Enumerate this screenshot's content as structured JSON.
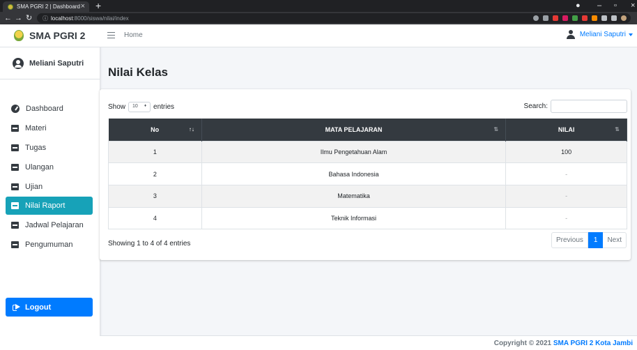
{
  "browser": {
    "tab_title": "SMA PGRI 2 | Dashboard",
    "url_host": "localhost",
    "url_rest": ":8000/siswa/nilai/index",
    "new_tab": "+",
    "tab_close": "×"
  },
  "sidebar": {
    "brand": "SMA PGRI 2",
    "user": "Meliani Saputri",
    "items": [
      {
        "label": "Dashboard",
        "icon": "dashboard-icon",
        "active": false
      },
      {
        "label": "Materi",
        "icon": "book-icon",
        "active": false
      },
      {
        "label": "Tugas",
        "icon": "book-icon",
        "active": false
      },
      {
        "label": "Ulangan",
        "icon": "book-icon",
        "active": false
      },
      {
        "label": "Ujian",
        "icon": "book-icon",
        "active": false
      },
      {
        "label": "Nilai Raport",
        "icon": "book-icon",
        "active": true
      },
      {
        "label": "Jadwal Pelajaran",
        "icon": "book-icon",
        "active": false
      },
      {
        "label": "Pengumuman",
        "icon": "book-icon",
        "active": false
      }
    ],
    "logout": "Logout"
  },
  "navbar": {
    "home": "Home",
    "user": "Meliani Saputri"
  },
  "page": {
    "title": "Nilai Kelas"
  },
  "table_controls": {
    "show": "Show",
    "length_value": "10",
    "entries": "entries",
    "search_label": "Search:",
    "search_value": ""
  },
  "table": {
    "headers": [
      "No",
      "MATA PELAJARAN",
      "NILAI"
    ],
    "rows": [
      [
        "1",
        "Ilmu Pengetahuan Alam",
        "100"
      ],
      [
        "2",
        "Bahasa Indonesia",
        "-"
      ],
      [
        "3",
        "Matematika",
        "-"
      ],
      [
        "4",
        "Teknik Informasi",
        "-"
      ]
    ]
  },
  "pagination": {
    "info": "Showing 1 to 4 of 4 entries",
    "previous": "Previous",
    "current": "1",
    "next": "Next"
  },
  "footer": {
    "text": "Copyright © 2021 ",
    "link": "SMA PGRI 2 Kota Jambi"
  },
  "colors": {
    "active": "#17a2b8",
    "primary": "#007bff",
    "dark": "#343a40"
  }
}
